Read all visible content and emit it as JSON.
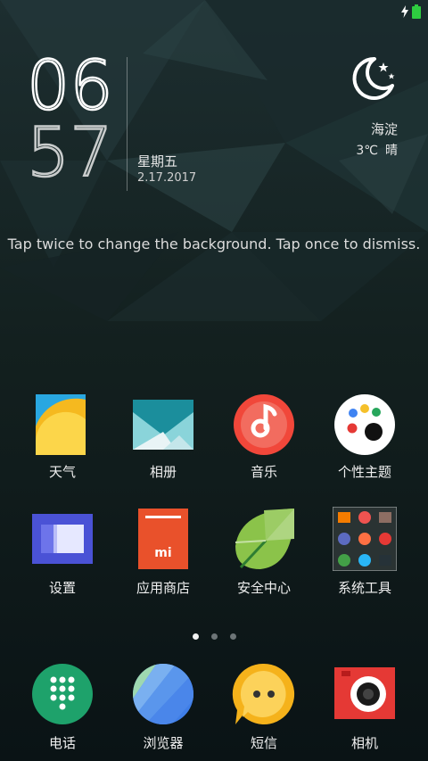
{
  "status_bar": {
    "battery_color": "#2ecc40"
  },
  "clock": {
    "hour": "06",
    "minute": "57",
    "weekday": "星期五",
    "date": "2.17.2017"
  },
  "weather": {
    "icon": "moon-icon",
    "city": "海淀",
    "temperature": "3℃",
    "condition": "晴"
  },
  "hint": "Tap twice to change the background. Tap once to dismiss.",
  "apps": [
    {
      "label": "天气",
      "icon": "weather-app-icon"
    },
    {
      "label": "相册",
      "icon": "gallery-app-icon"
    },
    {
      "label": "音乐",
      "icon": "music-app-icon"
    },
    {
      "label": "个性主题",
      "icon": "themes-app-icon"
    },
    {
      "label": "设置",
      "icon": "settings-app-icon"
    },
    {
      "label": "应用商店",
      "icon": "app-store-icon"
    },
    {
      "label": "安全中心",
      "icon": "security-app-icon"
    },
    {
      "label": "系统工具",
      "icon": "system-tools-folder-icon"
    }
  ],
  "page_indicator": {
    "total": 3,
    "active": 1
  },
  "dock": [
    {
      "label": "电话",
      "icon": "phone-app-icon"
    },
    {
      "label": "浏览器",
      "icon": "browser-app-icon"
    },
    {
      "label": "短信",
      "icon": "messages-app-icon"
    },
    {
      "label": "相机",
      "icon": "camera-app-icon"
    }
  ]
}
